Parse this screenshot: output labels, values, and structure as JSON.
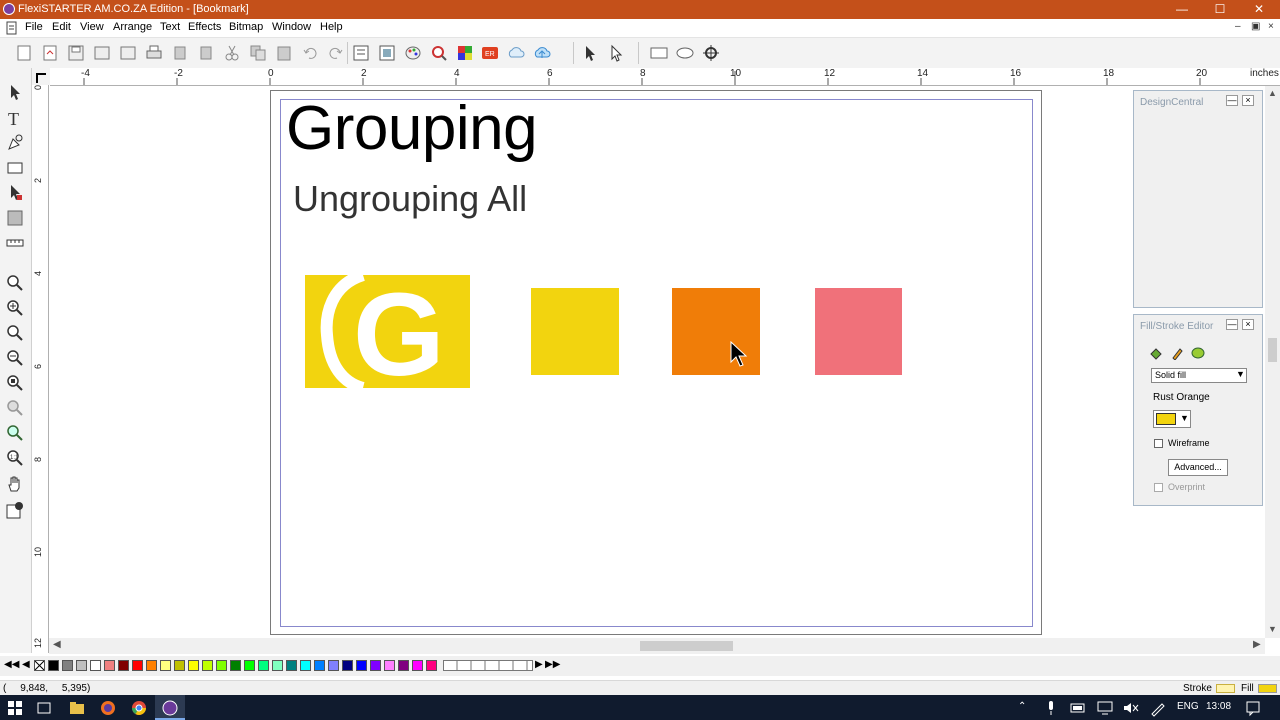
{
  "window": {
    "title": "FlexiSTARTER AM.CO.ZA Edition - [Bookmark]",
    "controls": {
      "minimize": "—",
      "maximize": "☐",
      "close": "✕"
    }
  },
  "menu": {
    "items": [
      "File",
      "Edit",
      "View",
      "Arrange",
      "Text",
      "Effects",
      "Bitmap",
      "Window",
      "Help"
    ],
    "mdi": {
      "minimize": "–",
      "restore": "▣",
      "close": "×"
    }
  },
  "ruler": {
    "horizontal": [
      "-4",
      "-2",
      "0",
      "2",
      "4",
      "6",
      "8",
      "10",
      "12",
      "14",
      "16",
      "18",
      "20"
    ],
    "unit": "inches",
    "vertical": [
      "0",
      "2",
      "4",
      "6",
      "8",
      "10",
      "12"
    ]
  },
  "canvas": {
    "title": "Grouping",
    "subtitle": "Ungrouping All",
    "g_letter": "G",
    "colors": {
      "yellow": "#f2d40f",
      "orange": "#f07d08",
      "pink": "#f0717a"
    }
  },
  "panels": {
    "design_central": {
      "title": "DesignCentral"
    },
    "fill_stroke": {
      "title": "Fill/Stroke Editor",
      "fill_type": "Solid fill",
      "color_name": "Rust Orange",
      "swatch_color": "#f2d40f",
      "wireframe_label": "Wireframe",
      "advanced_label": "Advanced...",
      "overprint_label": "Overprint"
    }
  },
  "palette": {
    "colors": [
      "#000000",
      "#808080",
      "#c0c0c0",
      "#ffffff",
      "#f08080",
      "#800000",
      "#ff0000",
      "#ff8000",
      "#ffff80",
      "#c0c000",
      "#ffff00",
      "#c0ff00",
      "#80ff00",
      "#008000",
      "#00ff00",
      "#00ff80",
      "#80ffc0",
      "#008080",
      "#00ffff",
      "#0080ff",
      "#8080ff",
      "#000080",
      "#0000ff",
      "#8000ff",
      "#ff80ff",
      "#800080",
      "#ff00ff",
      "#ff0080"
    ]
  },
  "status": {
    "coords": "(     9,848,     5,395)",
    "stroke_label": "Stroke",
    "fill_label": "Fill",
    "stroke_color": "#fff4b0",
    "fill_color": "#f2d40f"
  },
  "taskbar": {
    "lang": "ENG",
    "time": "13:08"
  }
}
